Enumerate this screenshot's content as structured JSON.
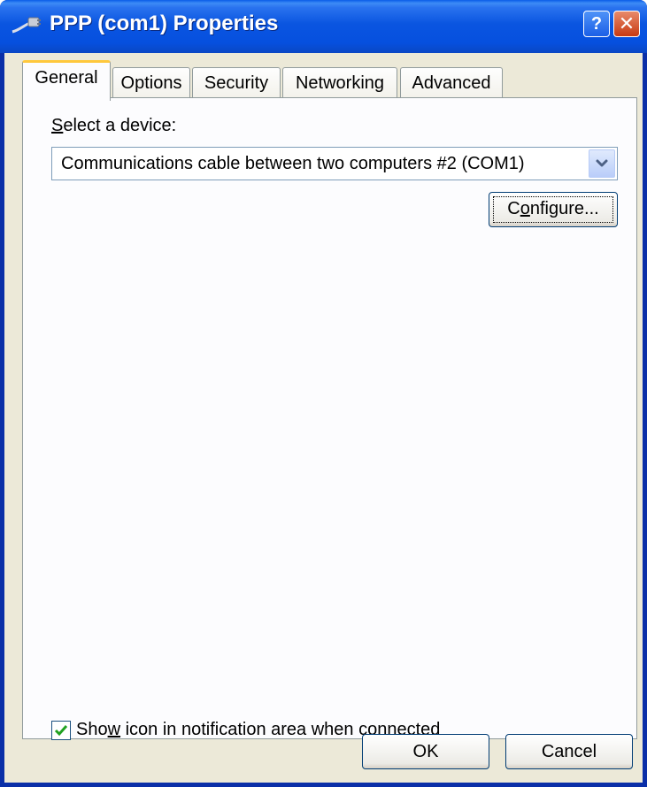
{
  "window": {
    "title": "PPP (com1) Properties",
    "help_glyph": "?",
    "close_glyph": "✕"
  },
  "tabs": [
    {
      "label": "General",
      "active": true
    },
    {
      "label": "Options"
    },
    {
      "label": "Security"
    },
    {
      "label": "Networking"
    },
    {
      "label": "Advanced"
    }
  ],
  "general": {
    "select_label_mnemonic": "S",
    "select_label_rest": "elect a device:",
    "device_value": "Communications cable between two computers #2 (COM1)",
    "configure_pre": "C",
    "configure_mnemonic": "o",
    "configure_post": "nfigure...",
    "show_icon_pre": "Sho",
    "show_icon_mnemonic": "w",
    "show_icon_post": " icon in notification area when connected",
    "show_icon_checked": true
  },
  "buttons": {
    "ok": "OK",
    "cancel": "Cancel"
  },
  "colors": {
    "titlebar": "#0a55e0",
    "dialog_bg": "#ece9d8",
    "tab_highlight": "#ffc83c",
    "checkmark": "#21a121"
  }
}
